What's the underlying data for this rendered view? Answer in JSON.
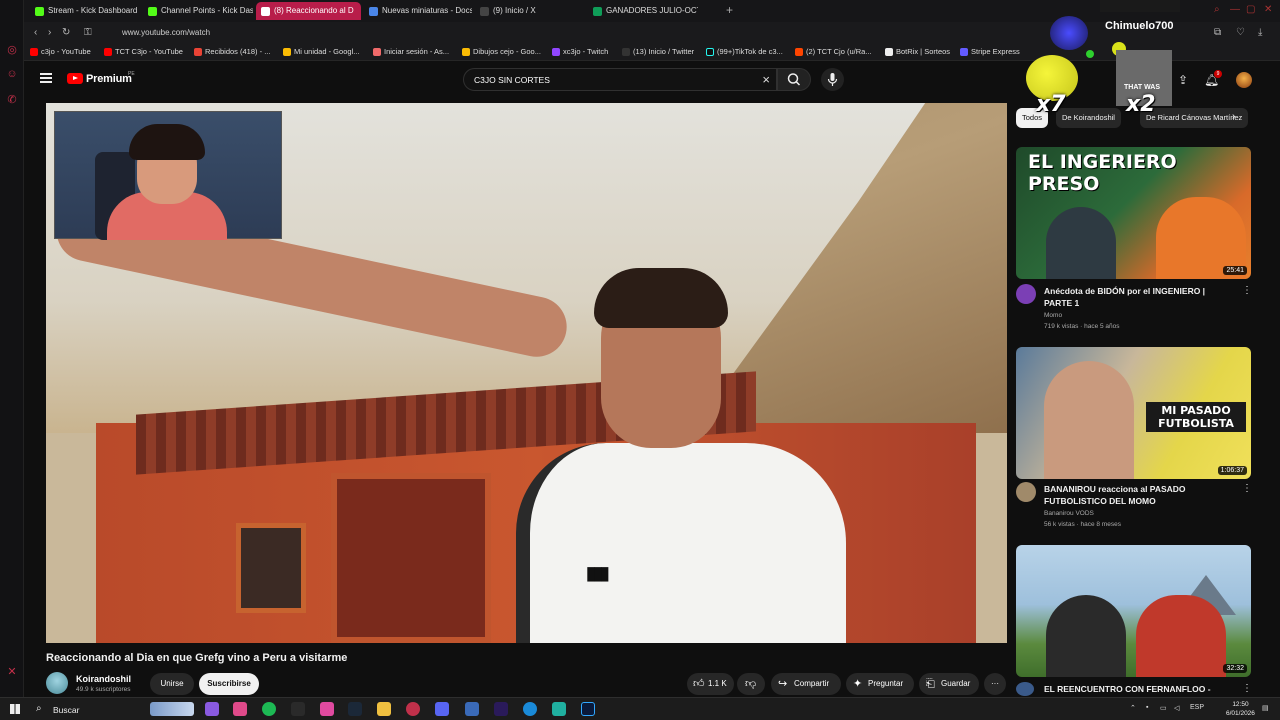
{
  "browser": {
    "tabs": [
      {
        "label": "Stream - Kick Dashboard",
        "active": false
      },
      {
        "label": "Channel Points - Kick Das",
        "active": false
      },
      {
        "label": "(8) Reaccionando al D",
        "active": true
      },
      {
        "label": "Nuevas miniaturas - Docs",
        "active": false
      },
      {
        "label": "(9) Inicio / X",
        "active": false
      },
      {
        "label": "GANADORES JULIO-OCT",
        "active": false
      }
    ],
    "url": "www.youtube.com/watch",
    "bookmarks": [
      "c3jo - YouTube",
      "TCT C3jo - YouTube",
      "Recibidos (418) - ...",
      "Mi unidad - Googl...",
      "Iniciar sesión - As...",
      "Dibujos cejo - Goo...",
      "xc3jo - Twitch",
      "(13) Inicio / Twitter",
      "(99+)TikTok de c3...",
      "(2) TCT Cjo (u/Ra...",
      "BotRix | Sorteos",
      "Stripe Express"
    ]
  },
  "header": {
    "brand": "Premium",
    "country": "PE",
    "search_value": "C3JO SIN CORTES",
    "notifications": "9"
  },
  "video": {
    "title": "Reaccionando al Dia en que Grefg vino a Peru a visitarme",
    "channel": "Koirandoshil",
    "subscribers": "49.9 k suscriptores",
    "join_label": "Unirse",
    "subscribe_label": "Suscribirse",
    "likes": "1.1 K",
    "share_label": "Compartir",
    "ask_label": "Preguntar",
    "save_label": "Guardar"
  },
  "sidebar": {
    "chips": [
      "Todos",
      "De Koirandoshil",
      "De Ricard Cánovas Martínez"
    ],
    "recommendations": [
      {
        "title": "Anécdota de BIDÓN por el INGENIERO | PARTE 1",
        "channel": "Momo",
        "meta": "719 k vistas · hace 5 años",
        "duration": "25:41",
        "thumb_text": "EL INGERIERO PRESO"
      },
      {
        "title": "BANANIROU reacciona al PASADO FUTBOLISTICO DEL MOMO",
        "channel": "Bananirou VODS",
        "meta": "56 k vistas · hace 8 meses",
        "duration": "1:06:37",
        "thumb_text": "MI PASADO FUTBOLISTA"
      },
      {
        "title": "EL REENCUENTRO CON FERNANFLOO -",
        "channel": "",
        "meta": "",
        "duration": "32:32",
        "thumb_text": ""
      }
    ]
  },
  "overlay": {
    "username": "Chimuelo700",
    "multiplier_a": "x7",
    "multiplier_b": "x2",
    "clip_caption": "THAT WAS"
  },
  "taskbar": {
    "search_label": "Buscar",
    "language": "ESP",
    "time": "12:50",
    "date": "6/01/2026"
  },
  "colors": {
    "youtube_red": "#ff0000",
    "active_tab": "#b81d4a",
    "background": "#0f0f0f"
  }
}
